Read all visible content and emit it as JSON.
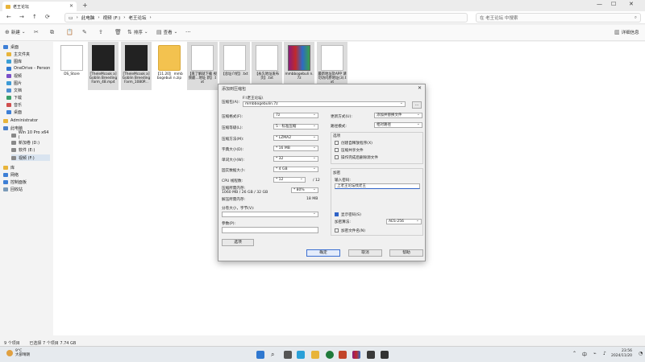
{
  "window": {
    "tab_title": "老王论坛",
    "minimize": "—",
    "maximize": "☐",
    "close": "✕",
    "new_tab": "+"
  },
  "nav": {
    "breadcrumbs": [
      "此电脑",
      "视频 (F:)",
      "老王论坛"
    ],
    "search_placeholder": "在 老王论坛 中搜索"
  },
  "toolbar": {
    "new_label": "新建",
    "sort_label": "排序",
    "view_label": "查看",
    "more_label": "···",
    "details_label": "详细信息"
  },
  "sidebar": {
    "items": [
      {
        "label": "桌面",
        "color": "#3d7fd6"
      },
      {
        "label": "主文件夹",
        "color": "#e8b43a"
      },
      {
        "label": "图库",
        "color": "#3a9fd6"
      },
      {
        "label": "OneDrive - Person",
        "color": "#2f78d0"
      },
      {
        "label": "视频",
        "color": "#7a4fc8"
      },
      {
        "label": "图片",
        "color": "#3d9bd6"
      },
      {
        "label": "文档",
        "color": "#4e8fd0"
      },
      {
        "label": "下载",
        "color": "#3a9f6a"
      },
      {
        "label": "音乐",
        "color": "#d04e4e"
      },
      {
        "label": "桌面",
        "color": "#3d7fd6"
      },
      {
        "label": "Administrator",
        "color": "#e8b43a"
      },
      {
        "label": "此电脑",
        "color": "#4a7fc8"
      },
      {
        "label": "Win 10 Pro x64 (",
        "color": "#888888"
      },
      {
        "label": "新加卷 (D:)",
        "color": "#888888"
      },
      {
        "label": "软件 (E:)",
        "color": "#888888"
      },
      {
        "label": "视频 (F:)",
        "color": "#888888"
      },
      {
        "label": "库",
        "color": "#e8b43a"
      },
      {
        "label": "网络",
        "color": "#3d7fd6"
      },
      {
        "label": "控制面板",
        "color": "#3d7fd6"
      },
      {
        "label": "回收站",
        "color": "#7a9ab8"
      }
    ]
  },
  "files": [
    {
      "name": "DS_Store",
      "kind": "doc"
    },
    {
      "name": "[TheleMcook a] Goblin Breeding Farm_48.mp4",
      "kind": "vid"
    },
    {
      "name": "[TheleMcook a] Goblin Breeding Farm_1080P...",
      "kind": "vid"
    },
    {
      "name": "【11.20】 mmbbogebuli n.zip",
      "kind": "zip"
    },
    {
      "name": "【来了解就下载 视频最…地址 新】.txt",
      "kind": "doc"
    },
    {
      "name": "【总址介绍】.txt",
      "kind": "doc"
    },
    {
      "name": "【永久地址发布页】.txt",
      "kind": "doc"
    },
    {
      "name": "mmbbogebuli n.7z",
      "kind": "rar"
    },
    {
      "name": "最新地址及APP 请勿访问原地址(3).txt",
      "kind": "doc"
    }
  ],
  "status": {
    "count": "9 个项目",
    "selected": "已选择 7 个项目 7.74 GB"
  },
  "dialog": {
    "title": "添加到压缩包",
    "path_hint": "F:\\老王论坛\\",
    "archive_label": "压缩包(A):",
    "archive_value": "mmbbogebulin.7z",
    "browse": "...",
    "format_label": "压缩格式(F):",
    "format_value": "7z",
    "level_label": "压缩等级(L):",
    "level_value": "5 - 标准压缩",
    "method_label": "压缩方法(M):",
    "method_value": "* LZMA2",
    "dict_label": "字典大小(D):",
    "dict_value": "* 16 MB",
    "word_label": "单词大小(W):",
    "word_value": "* 32",
    "solid_label": "固实数据大小:",
    "solid_value": "* 4 GB",
    "cpu_label": "CPU 线程数:",
    "cpu_value": "* 12",
    "cpu_total": "/ 12",
    "mem_label": "压缩所需内存:",
    "mem_detail": "1060 MB / 26 GB / 32 GB",
    "mem_value": "* 80%",
    "demem_label": "解压所需内存:",
    "demem_value": "18 MB",
    "split_label": "分卷大小，字节(V):",
    "params_label": "参数(P):",
    "options_btn": "选项",
    "update_label": "更新方式(U):",
    "update_value": "添加并替换文件",
    "pathmode_label": "路径模式:",
    "pathmode_value": "相对路径",
    "opts_title": "选项",
    "opt1": "创建自释放程序(X)",
    "opt2": "压缩共享文件",
    "opt3": "操作完成后删除源文件",
    "enc_title": "加密",
    "pwd_label": "输入密码:",
    "pwd_value": "上老王论坛找老王",
    "show_pwd": "显示密码(S)",
    "enc_method_label": "加密算法:",
    "enc_method_value": "AES-256",
    "enc_names": "加密文件名(N)",
    "ok": "确定",
    "cancel": "取消",
    "help": "帮助"
  },
  "taskbar": {
    "weather_temp": "9°C",
    "weather_desc": "大部晴朗",
    "time": "23:56",
    "date": "2024/11/20",
    "lang": "中"
  }
}
